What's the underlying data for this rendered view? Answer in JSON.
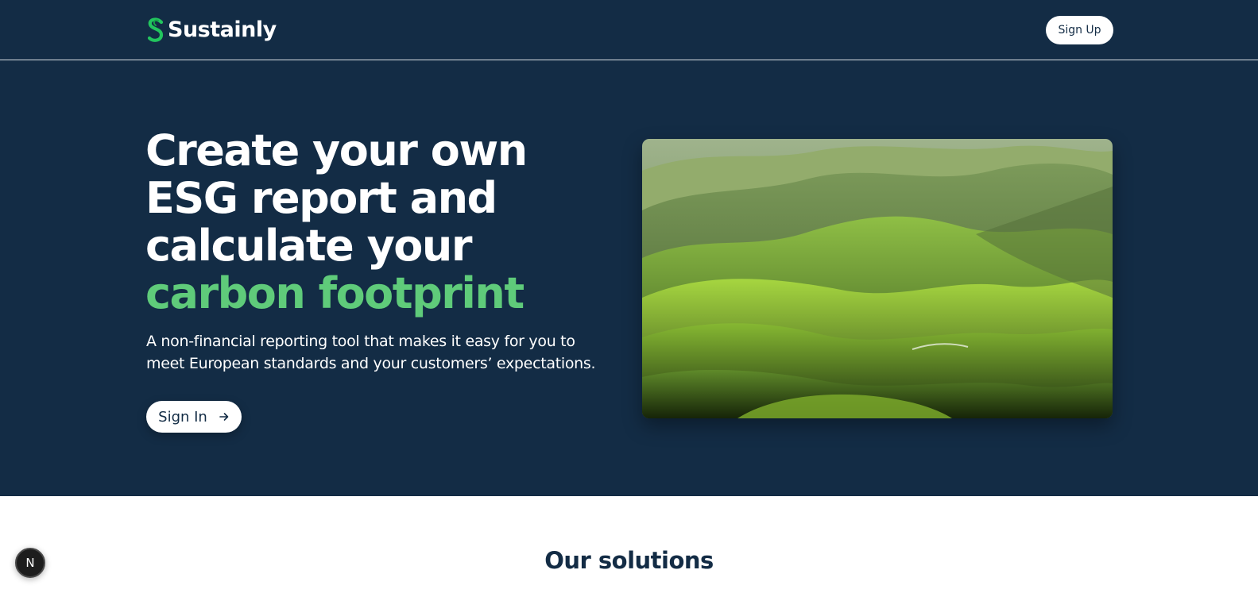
{
  "header": {
    "brand": "Sustainly",
    "signup_label": "Sign Up"
  },
  "hero": {
    "title_line1": "Create your own ESG report and calculate your",
    "title_highlight": "carbon footprint",
    "subtitle": "A non-financial reporting tool that makes it easy for you to meet European standards and your customers’ expectations.",
    "signin_label": "Sign In",
    "signin_icon": "arrow-right-icon",
    "image_subject": "green-rolling-hills-landscape"
  },
  "solutions": {
    "title": "Our solutions"
  },
  "dev_badge": {
    "label": "N"
  },
  "colors": {
    "navy": "#132c45",
    "accent_green": "#5fcb7a",
    "logo_green": "#22c55e",
    "white": "#ffffff"
  }
}
